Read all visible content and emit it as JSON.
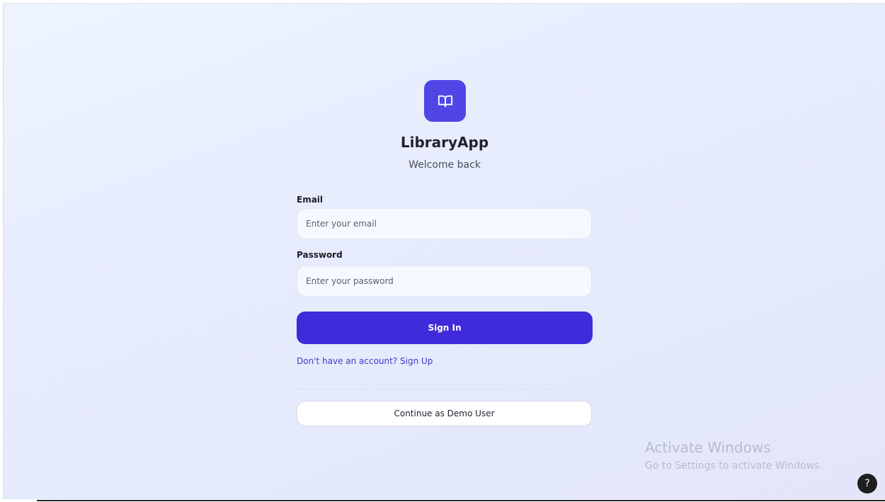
{
  "app": {
    "name": "LibraryApp",
    "tagline": "Welcome back",
    "logo_icon": "open-book-icon",
    "accent_color": "#4f46e5"
  },
  "form": {
    "email_label": "Email",
    "email_placeholder": "Enter your email",
    "email_value": "",
    "password_label": "Password",
    "password_placeholder": "Enter your password",
    "password_value": "",
    "submit_label": "Sign In",
    "submit_color": "#3f2bd9",
    "signup_link": "Don't have an account? Sign Up",
    "demo_label": "Continue as Demo User"
  },
  "watermark": {
    "title": "Activate Windows",
    "subtitle": "Go to Settings to activate Windows."
  },
  "help": {
    "icon": "help-icon",
    "label": "?"
  }
}
